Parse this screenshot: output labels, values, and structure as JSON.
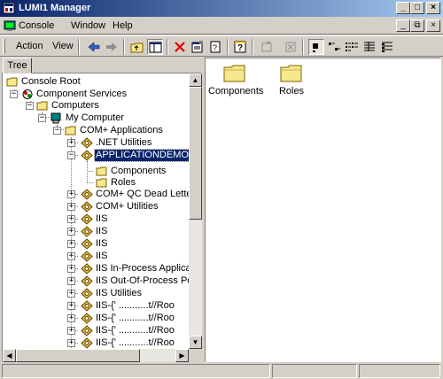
{
  "window": {
    "title": "LUMI1 Manager"
  },
  "menubar": {
    "items": [
      "Console",
      "Window",
      "Help"
    ]
  },
  "toolbar": {
    "action_label": "Action",
    "view_label": "View"
  },
  "tree_tab": {
    "label": "Tree"
  },
  "tree": {
    "nodes": [
      {
        "label": "Console Root"
      },
      {
        "label": "Component Services"
      },
      {
        "label": "Computers"
      },
      {
        "label": "My Computer"
      },
      {
        "label": "COM+ Applications"
      },
      {
        "label": ".NET Utilities"
      },
      {
        "label": "APPLICATIONDEMO"
      },
      {
        "label": "Components"
      },
      {
        "label": "Roles"
      },
      {
        "label": "COM+ QC Dead Letter Qu"
      },
      {
        "label": "COM+ Utilities"
      },
      {
        "label": "IIS"
      },
      {
        "label": "IIS"
      },
      {
        "label": "IIS"
      },
      {
        "label": "IIS"
      },
      {
        "label": "IIS In-Process Application"
      },
      {
        "label": "IIS Out-Of-Process Poole"
      },
      {
        "label": "IIS Utilities"
      },
      {
        "label": "IIS-{' ...........t//Roo"
      },
      {
        "label": "IIS-{' ...........t//Roo"
      },
      {
        "label": "IIS-{' ...........t//Roo"
      },
      {
        "label": "IIS-{' ...........t//Roo"
      }
    ]
  },
  "result_pane": {
    "items": [
      {
        "label": "Components"
      },
      {
        "label": "Roles"
      }
    ]
  },
  "colors": {
    "title_gradient_start": "#0a246a",
    "title_gradient_end": "#a6caf0",
    "folder_yellow": "#f6e88c",
    "selection": "#0a246a"
  }
}
